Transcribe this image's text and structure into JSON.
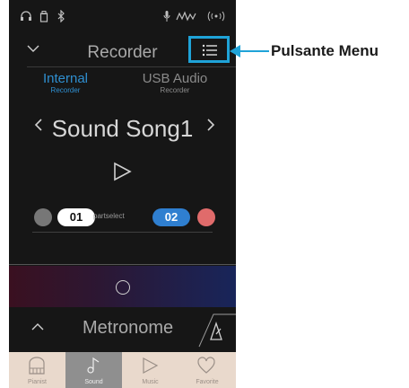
{
  "header": {
    "title": "Recorder"
  },
  "tabs": [
    {
      "label": "Internal",
      "sub": "Recorder"
    },
    {
      "label": "USB Audio",
      "sub": "Recorder"
    }
  ],
  "song": {
    "name": "Sound Song1"
  },
  "parts": {
    "left": "01",
    "right": "02",
    "select_label": "partselect"
  },
  "metronome": {
    "label": "Metronome"
  },
  "bottom_nav": [
    {
      "label": "Pianist"
    },
    {
      "label": "Sound"
    },
    {
      "label": "Music"
    },
    {
      "label": "Favorite"
    }
  ],
  "callout": {
    "text": "Pulsante Menu"
  },
  "colors": {
    "accent": "#1fa3d8",
    "part_left": "#ffffff",
    "part_right": "#2f7fd0",
    "dot_right": "#e06b6b"
  },
  "icons": [
    "headphones-icon",
    "usb-icon",
    "bluetooth-icon",
    "microphone-icon",
    "signal-icon",
    "wifi-icon",
    "menu-list-icon",
    "play-icon",
    "record-icon",
    "metronome-icon",
    "piano-icon",
    "note-icon",
    "play-nav-icon",
    "heart-icon"
  ]
}
